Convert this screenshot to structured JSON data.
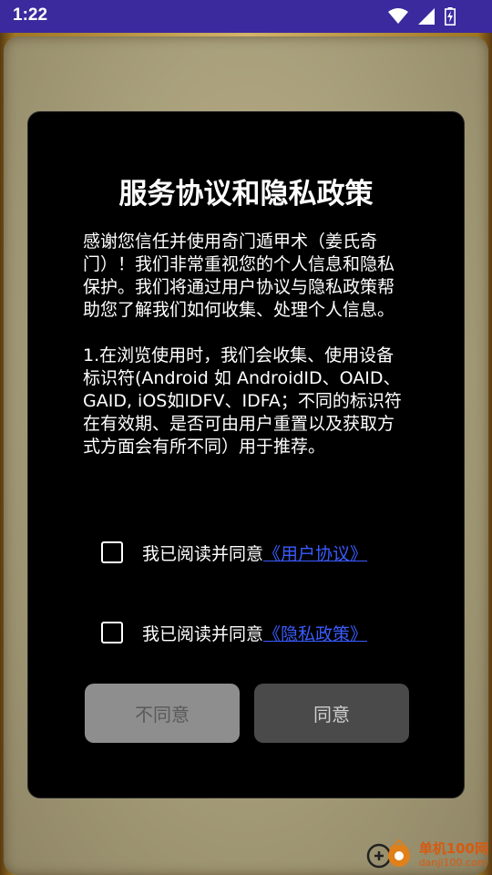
{
  "status": {
    "time": "1:22"
  },
  "dialog": {
    "title": "服务协议和隐私政策",
    "paragraph1": "感谢您信任并使用奇门遁甲术（姜氏奇门）！我们非常重视您的个人信息和隐私保护。我们将通过用户协议与隐私政策帮助您了解我们如何收集、处理个人信息。",
    "paragraph2": "1.在浏览使用时，我们会收集、使用设备标识符(Android 如 AndroidID、OAID、GAID, iOS如IDFV、IDFA；不同的标识符在有效期、是否可由用户重置以及获取方式方面会有所不同）用于推荐。",
    "agree_prefix": "我已阅读并同意",
    "user_agreement_link": "《用户协议》",
    "privacy_policy_link": "《隐私政策》",
    "disagree_label": "不同意",
    "agree_label": "同意"
  },
  "watermark": {
    "name": "单机100网",
    "url": "danji100.com"
  }
}
